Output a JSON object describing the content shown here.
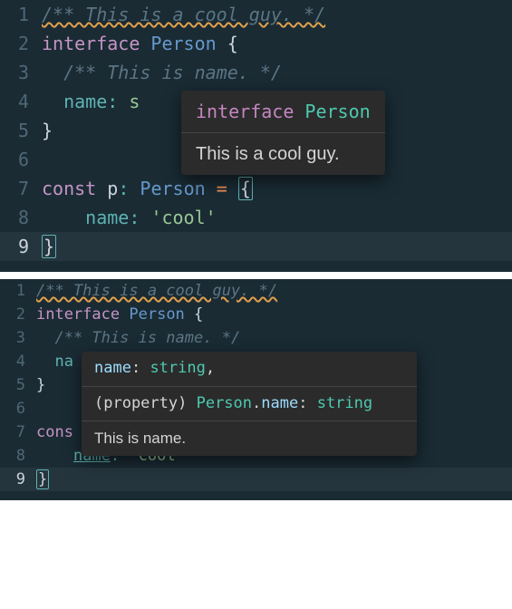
{
  "panes": [
    {
      "lines": {
        "l1": "/** This is a cool guy. */",
        "l2_interface": "interface",
        "l2_type": "Person",
        "l2_br": "{",
        "l3": "/** This is name. */",
        "l4_prop": "name",
        "l4_colon": ":",
        "l4_partial": "s",
        "l5_close": "}",
        "l7_const": "const",
        "l7_var": "p",
        "l7_colon": ":",
        "l7_type": "Person",
        "l7_eq": "=",
        "l7_open": "{",
        "l8_prop": "name",
        "l8_colon": ":",
        "l8_str": "'cool'",
        "l9_close": "}"
      },
      "gutters": [
        "1",
        "2",
        "3",
        "4",
        "5",
        "6",
        "7",
        "8",
        "9"
      ],
      "hover": {
        "sig_kw": "interface",
        "sig_type": "Person",
        "doc": "This is a cool guy."
      }
    },
    {
      "lines": {
        "l1": "/** This is a cool guy. */",
        "l2_interface": "interface",
        "l2_type": "Person",
        "l2_br": "{",
        "l3": "/** This is name. */",
        "l4_partial": "na",
        "l5_close": "}",
        "l7_const": "cons",
        "l8_prop": "name",
        "l8_colon": ":",
        "l8_str": "'cool'",
        "l9_close": "}"
      },
      "gutters": [
        "1",
        "2",
        "3",
        "4",
        "5",
        "6",
        "7",
        "8",
        "9"
      ],
      "hover": {
        "sig1_prop": "name",
        "sig1_colon": ": ",
        "sig1_type": "string",
        "sig1_comma": ",",
        "sig2_prefix": "(property) ",
        "sig2_owner": "Person",
        "sig2_dot": ".",
        "sig2_prop": "name",
        "sig2_colon": ": ",
        "sig2_type": "string",
        "doc": "This is name."
      }
    }
  ]
}
